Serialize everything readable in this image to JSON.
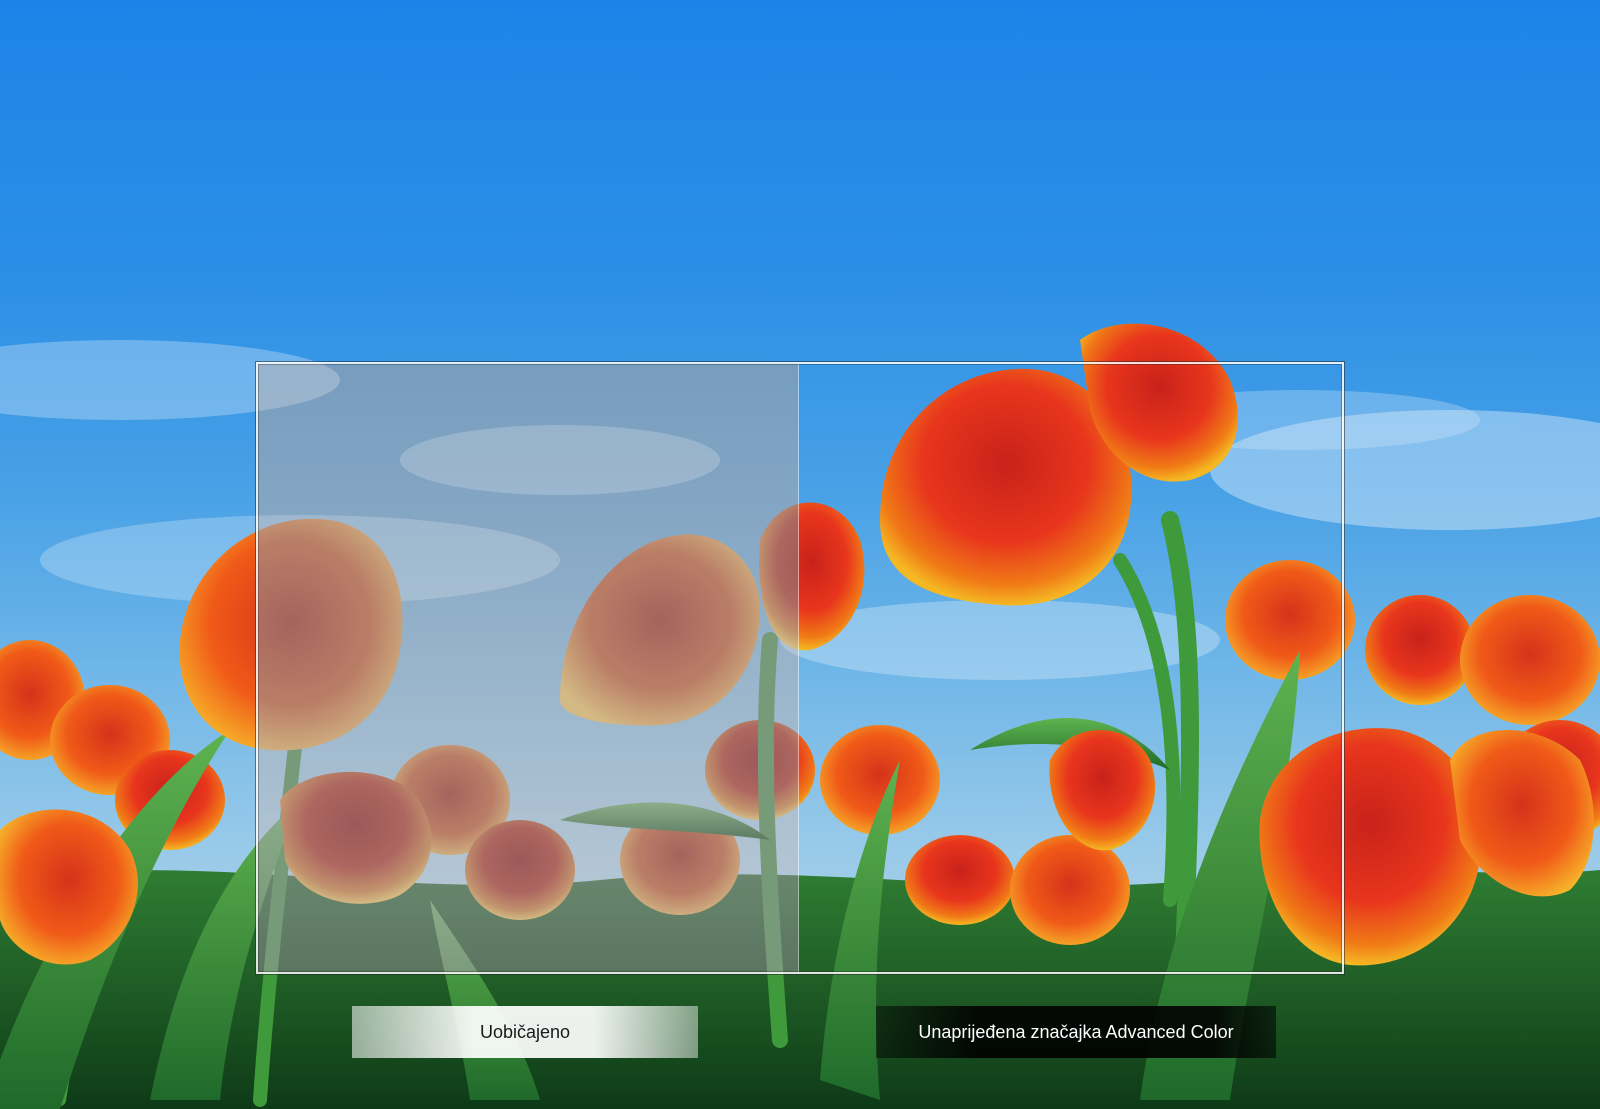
{
  "comparison": {
    "left_label": "Uobičajeno",
    "right_label": "Unaprijeđena značajka Advanced Color"
  },
  "colors": {
    "sky_top": "#1c84e8",
    "sky_bottom": "#b7d8ea",
    "tulip_red": "#e8351d",
    "tulip_orange": "#f07a16",
    "tulip_yellow": "#f5b823",
    "stem_green": "#3f9a3c"
  }
}
